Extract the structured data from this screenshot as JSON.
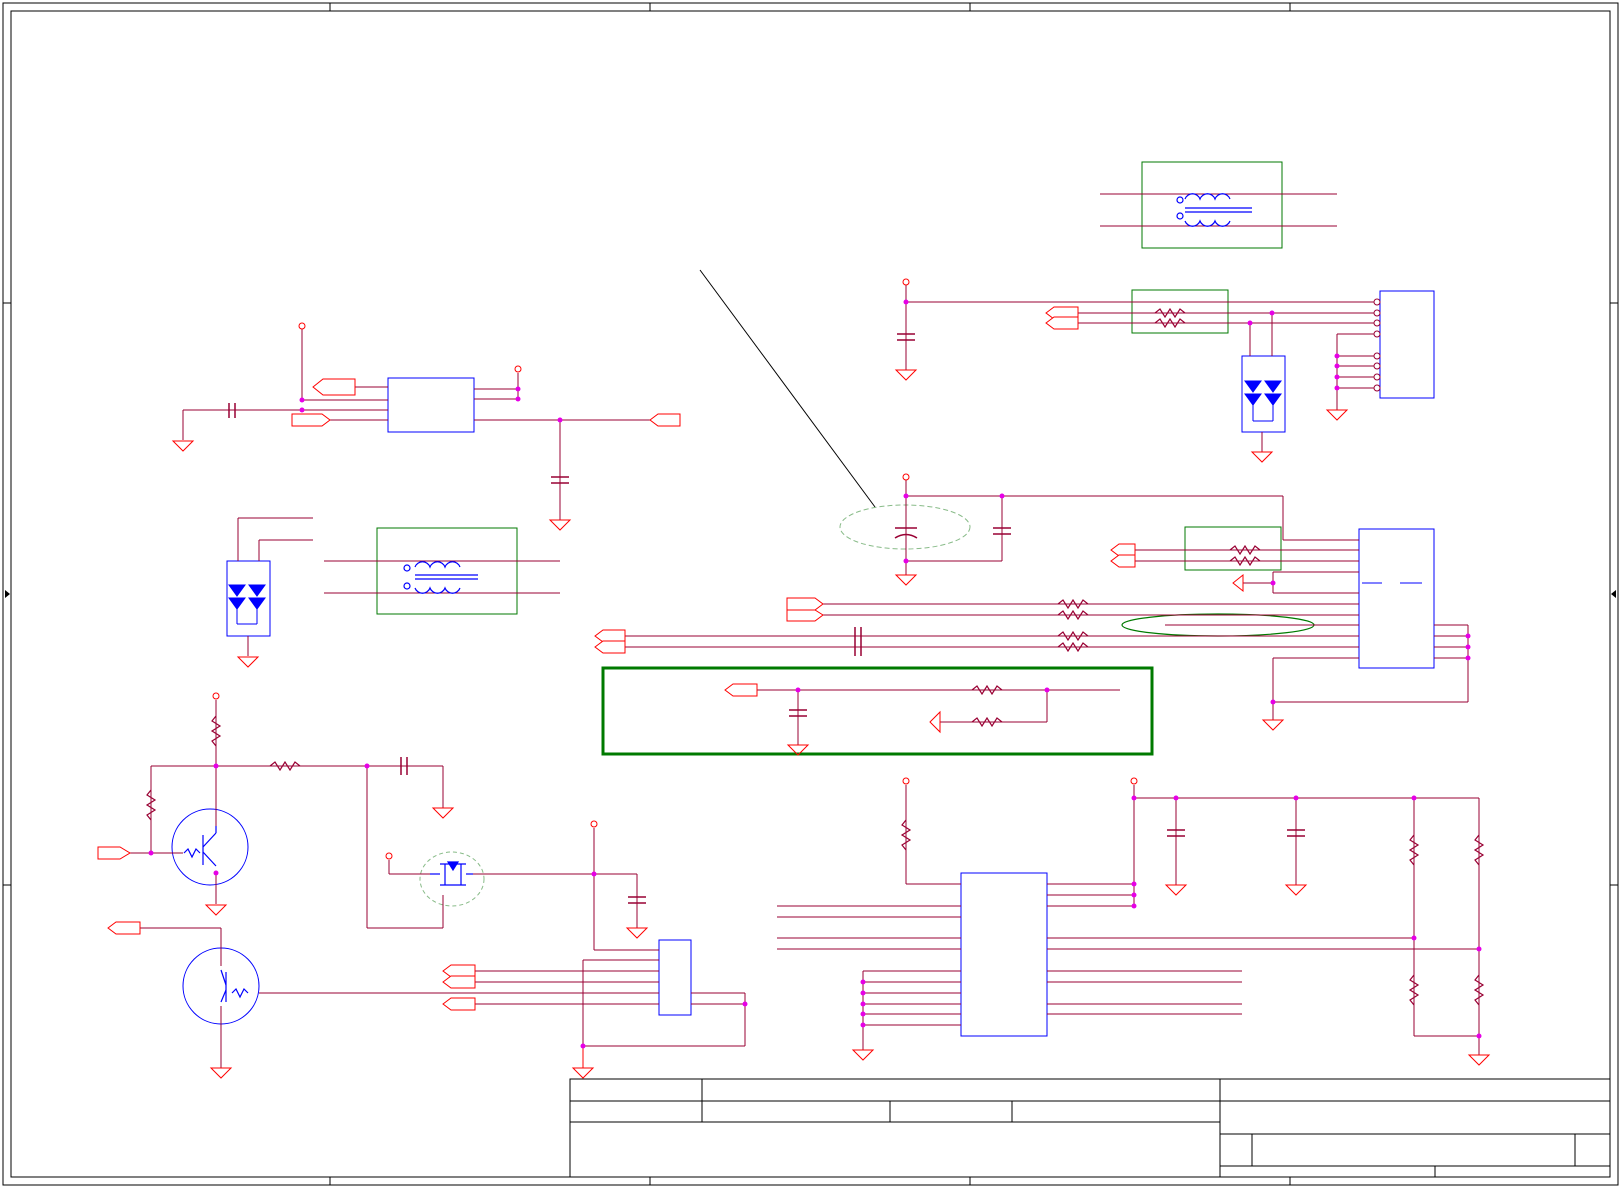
{
  "sheet": {
    "title_block": {
      "title_text": "",
      "size_text": "",
      "document_number_text": "",
      "revision_text": "",
      "date_text": "",
      "sheet_text": ""
    }
  },
  "colors": {
    "wire": "#990033",
    "net_pin": "#ff0000",
    "junction": "#e600e6",
    "component_body": "#0000ff",
    "highlight_green": "#007a00",
    "highlight_dashed": "#66bb66",
    "frame": "#000000"
  }
}
